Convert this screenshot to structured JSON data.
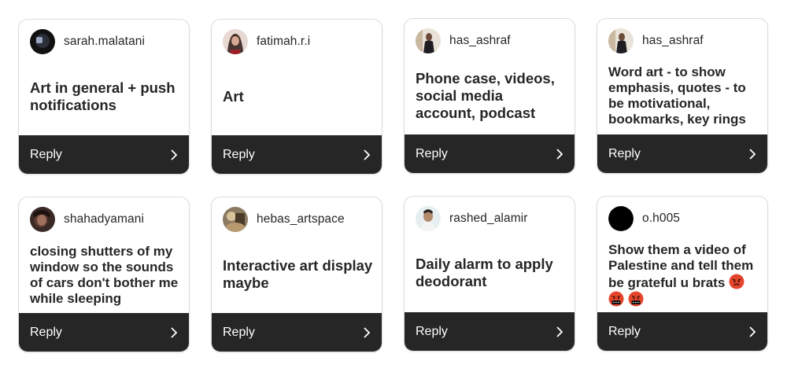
{
  "cards": [
    {
      "username": "sarah.malatani",
      "text": "Art in general + push notifications",
      "reply": "Reply"
    },
    {
      "username": "fatimah.r.i",
      "text": "Art",
      "reply": "Reply"
    },
    {
      "username": "has_ashraf",
      "text": "Phone case, videos, social media account, podcast",
      "reply": "Reply"
    },
    {
      "username": "has_ashraf",
      "text": "Word art - to show emphasis, quotes - to be motivational, bookmarks, key rings",
      "reply": "Reply"
    },
    {
      "username": "shahadyamani",
      "text": "closing shutters of my window so the sounds of cars don't bother me while sleeping",
      "reply": "Reply"
    },
    {
      "username": "hebas_artspace",
      "text": "Interactive art display maybe",
      "reply": "Reply"
    },
    {
      "username": "rashed_alamir",
      "text": "Daily alarm to apply deodorant",
      "reply": "Reply"
    },
    {
      "username": "o.h005",
      "text": "Show them a video of Palestine and tell them be grateful u brats",
      "reply": "Reply"
    }
  ],
  "icons": {
    "chevron": "chevron-right-icon",
    "emoji": "angry-face-emoji"
  },
  "colors": {
    "reply_bar": "#262626",
    "text": "#262626",
    "card_border": "#dcdcdc"
  }
}
